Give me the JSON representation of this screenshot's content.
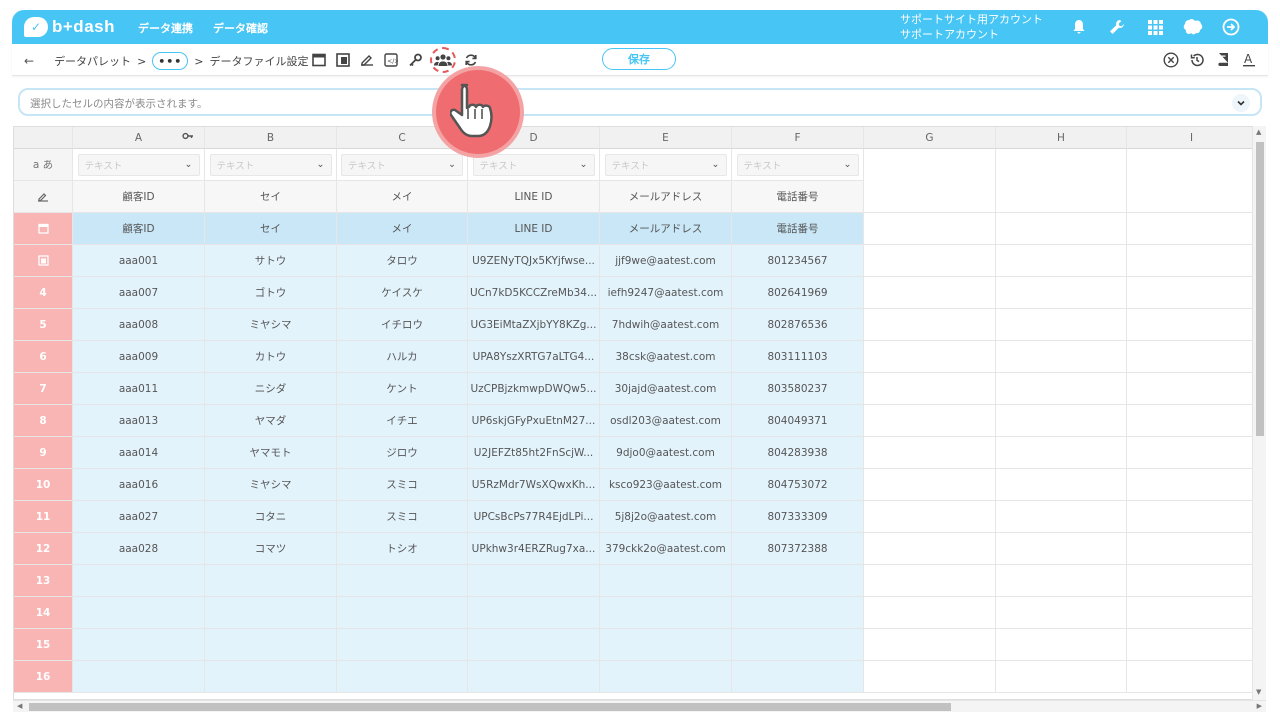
{
  "header": {
    "logo_text": "b+dash",
    "nav": [
      "データ連携",
      "データ確認"
    ],
    "account_line1": "サポートサイト用アカウント",
    "account_line2": "サポートアカウント",
    "icons": [
      "bell-icon",
      "wrench-icon",
      "grid-icon",
      "brain-icon",
      "logout-icon"
    ]
  },
  "toolbar": {
    "back_icon": "arrow-left-icon",
    "crumb_palette": "データパレット",
    "crumb_sep": ">",
    "crumb_dots": "•••",
    "crumb_settings": "データファイル設定",
    "save_label": "保存",
    "tool_icons": [
      "window-icon",
      "panel-icon",
      "pencil-icon",
      "code-icon",
      "key-icon",
      "users-icon",
      "refresh-icon"
    ],
    "right_icons": [
      "close-circle-icon",
      "history-icon",
      "book-icon",
      "text-a-icon"
    ]
  },
  "cellbar": {
    "placeholder": "選択したセルの内容が表示されます。"
  },
  "grid": {
    "columns": [
      "A",
      "B",
      "C",
      "D",
      "E",
      "F",
      "G",
      "H",
      "I"
    ],
    "type_row_label": "a あ",
    "type_placeholder": "テキスト",
    "field_names": [
      "顧客ID",
      "セイ",
      "メイ",
      "LINE ID",
      "メールアドレス",
      "電話番号"
    ],
    "display_names": [
      "顧客ID",
      "セイ",
      "メイ",
      "LINE ID",
      "メールアドレス",
      "電話番号"
    ],
    "rows": [
      [
        "aaa001",
        "サトウ",
        "タロウ",
        "U9ZENyTQJx5KYjfwse...",
        "jjf9we@aatest.com",
        "801234567"
      ],
      [
        "aaa007",
        "ゴトウ",
        "ケイスケ",
        "UCn7kD5KCCZreMb34...",
        "iefh9247@aatest.com",
        "802641969"
      ],
      [
        "aaa008",
        "ミヤシマ",
        "イチロウ",
        "UG3EiMtaZXjbYY8KZg...",
        "7hdwih@aatest.com",
        "802876536"
      ],
      [
        "aaa009",
        "カトウ",
        "ハルカ",
        "UPA8YszXRTG7aLTG4...",
        "38csk@aatest.com",
        "803111103"
      ],
      [
        "aaa011",
        "ニシダ",
        "ケント",
        "UzCPBjzkmwpDWQw5...",
        "30jajd@aatest.com",
        "803580237"
      ],
      [
        "aaa013",
        "ヤマダ",
        "イチエ",
        "UP6skjGFyPxuEtnM27...",
        "osdl203@aatest.com",
        "804049371"
      ],
      [
        "aaa014",
        "ヤマモト",
        "ジロウ",
        "U2JEFZt85ht2FnScjW...",
        "9djo0@aatest.com",
        "804283938"
      ],
      [
        "aaa016",
        "ミヤシマ",
        "スミコ",
        "U5RzMdr7WsXQwxKh...",
        "ksco923@aatest.com",
        "804753072"
      ],
      [
        "aaa027",
        "コタニ",
        "スミコ",
        "UPCsBcPs77R4EjdLPi...",
        "5j8j2o@aatest.com",
        "807333309"
      ],
      [
        "aaa028",
        "コマツ",
        "トシオ",
        "UPkhw3r4ERZRug7xa...",
        "379ckk2o@aatest.com",
        "807372388"
      ]
    ],
    "row_numbers": [
      "4",
      "5",
      "6",
      "7",
      "8",
      "9",
      "10",
      "11",
      "12",
      "13",
      "14",
      "15",
      "16"
    ],
    "row_icons": [
      "edit-icon",
      "calendar-icon",
      "table-icon"
    ],
    "colors": {
      "header_blue": "#47c5f4",
      "data_bg": "#e3f3fc",
      "rownum_pink": "#f9b4b4",
      "pointer_red": "#ef6d70"
    }
  },
  "pointer": {
    "icon": "hand-pointer-icon"
  }
}
